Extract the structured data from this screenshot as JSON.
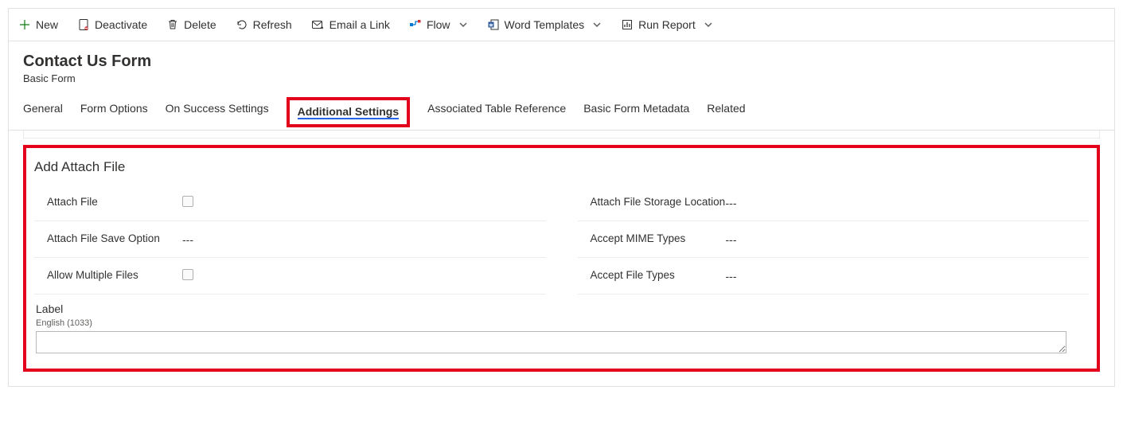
{
  "commands": {
    "new": "New",
    "deactivate": "Deactivate",
    "delete": "Delete",
    "refresh": "Refresh",
    "email": "Email a Link",
    "flow": "Flow",
    "word": "Word Templates",
    "report": "Run Report"
  },
  "header": {
    "title": "Contact Us Form",
    "subtitle": "Basic Form"
  },
  "tabs": {
    "general": "General",
    "formOptions": "Form Options",
    "onSuccess": "On Success Settings",
    "additional": "Additional Settings",
    "associated": "Associated Table Reference",
    "metadata": "Basic Form Metadata",
    "related": "Related"
  },
  "section": {
    "title": "Add Attach File",
    "left": {
      "attachFile": "Attach File",
      "saveOption": "Attach File Save Option",
      "saveOptionVal": "---",
      "allowMultiple": "Allow Multiple Files"
    },
    "right": {
      "storage": "Attach File Storage Location",
      "storageVal": "---",
      "mime": "Accept MIME Types",
      "mimeVal": "---",
      "fileTypes": "Accept File Types",
      "fileTypesVal": "---"
    },
    "label": "Label",
    "labelLang": "English (1033)"
  }
}
